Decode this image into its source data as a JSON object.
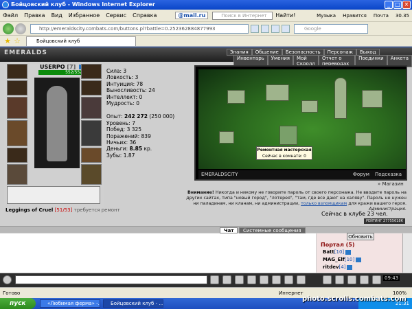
{
  "window": {
    "title": "Бойцовский клуб - Windows Internet Explorer"
  },
  "menu": {
    "items": [
      "Файл",
      "Правка",
      "Вид",
      "Избранное",
      "Сервис",
      "Справка"
    ]
  },
  "toolbar": {
    "mailru": "@mail.ru",
    "search_placeholder": "Поиск в Интернет",
    "find": "Найти!",
    "music": "Музыка",
    "like": "Нравится",
    "mail": "Почта",
    "weather": "30.35"
  },
  "address": {
    "url": "http://emeraldscity.combats.com/buttons.pl?battle=0.252362884877993",
    "search_placeholder": "Google"
  },
  "tab": {
    "label": "Бойцовский клуб"
  },
  "game": {
    "logo": "EMERALDS",
    "nav_top": [
      "Знания",
      "Общение",
      "Безопасность",
      "Персонаж",
      "Выход"
    ],
    "nav_bottom": [
      "Инвентарь",
      "Умения",
      "Мой Скролл",
      "Отчет о переводах",
      "Поединки",
      "Анкета"
    ],
    "character": {
      "name": "USERPO",
      "level": "[7]",
      "hp": "552/552",
      "stats": [
        {
          "label": "Сила:",
          "value": "3"
        },
        {
          "label": "Ловкость:",
          "value": "3"
        },
        {
          "label": "Интуиция:",
          "value": "78"
        },
        {
          "label": "Выносливость:",
          "value": "24"
        },
        {
          "label": "Интеллект:",
          "value": "0"
        },
        {
          "label": "Мудрость:",
          "value": "0"
        }
      ],
      "experience": {
        "label": "Опыт:",
        "value": "242 272",
        "next": "(250 000)"
      },
      "info": [
        {
          "label": "Уровень:",
          "value": "7"
        },
        {
          "label": "Побед:",
          "value": "3 325"
        },
        {
          "label": "Поражений:",
          "value": "839"
        },
        {
          "label": "Ничьих:",
          "value": "36"
        }
      ],
      "money": {
        "label": "Деньги:",
        "value": "8.85",
        "unit": "кр."
      },
      "teeth": {
        "label": "Зубы:",
        "value": "1.87"
      }
    },
    "item": {
      "name": "Leggings of Cruel",
      "durability": "[51/53]",
      "note": "требуется ремонт"
    },
    "map": {
      "tooltip_title": "Ремонтная мастерская",
      "tooltip_sub": "Сейчас в комнате: 0",
      "location": "EMERALDSCITY",
      "links": [
        "Форум",
        "Подсказка"
      ],
      "shop": "Магазин"
    },
    "warning": {
      "bold": "Внимание!",
      "text": "Никогда и никому не говорите пароль от своего персонажа. Не вводите пароль на других сайтах, типа \"новый город\", \"лотерея\", \"там, где все дают на халяву\". Пароль не нужен ни паладинам, ни кланам, ни администрации,",
      "link": "только взломщикам",
      "tail": "для кражи вашего героя.",
      "sign": "Администрация."
    },
    "online": "Сейчас в клубе 23 чел.",
    "counter": "РЕЙТИНГ 27755618К",
    "chat_tabs": [
      "Чат",
      "Системные сообщения"
    ],
    "refresh": "Обновить",
    "portal": "Портал (5)",
    "users": [
      {
        "name": "Batt",
        "level": "[10]"
      },
      {
        "name": "MAG_Elf",
        "level": "[10]"
      },
      {
        "name": "ritdev",
        "level": "[4]"
      }
    ],
    "clock": "09:43"
  },
  "status": {
    "left": "Готово",
    "zone": "Интернет",
    "zoom": "100%"
  },
  "taskbar": {
    "start": "пуск",
    "tasks": [
      "«Любимая ферма» -...",
      "Бойцовский клуб - ..."
    ],
    "clock": "21:31"
  },
  "watermark": "photo.scrolls.combats.com"
}
